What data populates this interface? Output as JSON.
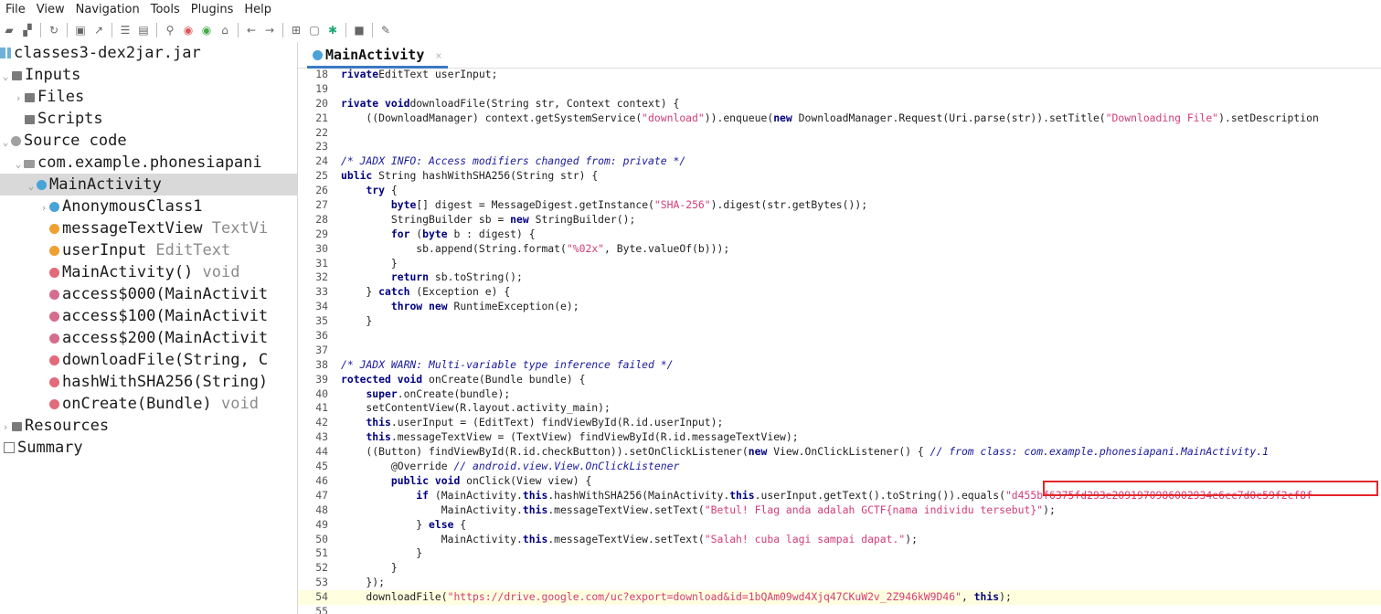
{
  "menu": [
    "File",
    "View",
    "Navigation",
    "Tools",
    "Plugins",
    "Help"
  ],
  "tree": {
    "root": "classes3-dex2jar.jar",
    "inputs": "Inputs",
    "files": "Files",
    "scripts": "Scripts",
    "source_code": "Source code",
    "package": "com.example.phonesiapani",
    "class": "MainActivity",
    "members": [
      {
        "name": "AnonymousClass1",
        "type": ""
      },
      {
        "name": "messageTextView ",
        "type": "TextVi"
      },
      {
        "name": "userInput ",
        "type": "EditText"
      },
      {
        "name": "MainActivity() ",
        "type": "void"
      },
      {
        "name": "access$000(MainActivit",
        "type": ""
      },
      {
        "name": "access$100(MainActivit",
        "type": ""
      },
      {
        "name": "access$200(MainActivit",
        "type": ""
      },
      {
        "name": "downloadFile(String, C",
        "type": ""
      },
      {
        "name": "hashWithSHA256(String)",
        "type": ""
      },
      {
        "name": "onCreate(Bundle) ",
        "type": "void"
      }
    ],
    "resources": "Resources",
    "summary": "Summary"
  },
  "tab": {
    "label": "MainActivity",
    "close": "×"
  },
  "code": {
    "lines": [
      {
        "n": "18",
        "parts": [
          [
            "kw",
            "rivate"
          ],
          [
            "",
            "EditText userInput;"
          ]
        ]
      },
      {
        "n": "19",
        "parts": []
      },
      {
        "n": "20",
        "parts": [
          [
            "kw",
            "rivate void"
          ],
          [
            "",
            "downloadFile(String str, Context context) {"
          ]
        ]
      },
      {
        "n": "21",
        "parts": [
          [
            "",
            "    ((DownloadManager) context.getSystemService("
          ],
          [
            "str",
            "\"download\""
          ],
          [
            "",
            "))."
          ],
          [
            "",
            "enqueue("
          ],
          [
            "kw",
            "new"
          ],
          [
            "",
            " DownloadManager.Request(Uri.parse(str)).setTitle("
          ],
          [
            "str",
            "\"Downloading File\""
          ],
          [
            "",
            ").setDescription"
          ]
        ]
      },
      {
        "n": "22",
        "parts": [
          [
            "",
            ""
          ]
        ]
      },
      {
        "n": "23",
        "parts": []
      },
      {
        "n": "24",
        "parts": [
          [
            "cm",
            "/* JADX INFO: Access modifiers changed from: private */"
          ]
        ]
      },
      {
        "n": "25",
        "parts": [
          [
            "kw",
            "ublic"
          ],
          [
            "",
            " String hashWithSHA256(String str) {"
          ]
        ]
      },
      {
        "n": "26",
        "parts": [
          [
            "",
            "    "
          ],
          [
            "kw",
            "try"
          ],
          [
            "",
            " {"
          ]
        ]
      },
      {
        "n": "27",
        "parts": [
          [
            "",
            "        "
          ],
          [
            "kw",
            "byte"
          ],
          [
            "",
            "[] digest = MessageDigest.getInstance("
          ],
          [
            "str",
            "\"SHA-256\""
          ],
          [
            "",
            ").digest(str.getBytes());"
          ]
        ]
      },
      {
        "n": "28",
        "parts": [
          [
            "",
            "        StringBuilder sb = "
          ],
          [
            "kw",
            "new"
          ],
          [
            "",
            " StringBuilder();"
          ]
        ]
      },
      {
        "n": "29",
        "parts": [
          [
            "",
            "        "
          ],
          [
            "kw",
            "for"
          ],
          [
            "",
            " ("
          ],
          [
            "kw",
            "byte"
          ],
          [
            "",
            " b : digest) {"
          ]
        ]
      },
      {
        "n": "30",
        "parts": [
          [
            "",
            "            sb.append(String.format("
          ],
          [
            "str",
            "\"%02x\""
          ],
          [
            "",
            ", Byte.valueOf(b)));"
          ]
        ]
      },
      {
        "n": "31",
        "parts": [
          [
            "",
            "        }"
          ]
        ]
      },
      {
        "n": "32",
        "parts": [
          [
            "",
            "        "
          ],
          [
            "kw",
            "return"
          ],
          [
            "",
            " sb.toString();"
          ]
        ]
      },
      {
        "n": "33",
        "parts": [
          [
            "",
            "    } "
          ],
          [
            "kw",
            "catch"
          ],
          [
            "",
            " (Exception e) {"
          ]
        ]
      },
      {
        "n": "34",
        "parts": [
          [
            "",
            "        "
          ],
          [
            "kw",
            "throw new"
          ],
          [
            "",
            " RuntimeException(e);"
          ]
        ]
      },
      {
        "n": "35",
        "parts": [
          [
            "",
            "    }"
          ]
        ]
      },
      {
        "n": "36",
        "parts": [
          [
            "",
            ""
          ]
        ]
      },
      {
        "n": "37",
        "parts": []
      },
      {
        "n": "38",
        "parts": [
          [
            "cm",
            "/* JADX WARN: Multi-variable type inference failed */"
          ]
        ]
      },
      {
        "n": "39",
        "parts": [
          [
            "kw",
            "rotected void"
          ],
          [
            "",
            " onCreate(Bundle bundle) {"
          ]
        ]
      },
      {
        "n": "40",
        "parts": [
          [
            "",
            "    "
          ],
          [
            "kw",
            "super"
          ],
          [
            "",
            ".onCreate(bundle);"
          ]
        ]
      },
      {
        "n": "41",
        "parts": [
          [
            "",
            "    setContentView(R.layout.activity_main);"
          ]
        ]
      },
      {
        "n": "42",
        "parts": [
          [
            "",
            "    "
          ],
          [
            "kw",
            "this"
          ],
          [
            "",
            ".userInput = (EditText) findViewById(R.id.userInput);"
          ]
        ]
      },
      {
        "n": "43",
        "parts": [
          [
            "",
            "    "
          ],
          [
            "kw",
            "this"
          ],
          [
            "",
            ".messageTextView = (TextView) findViewById(R.id.messageTextView);"
          ]
        ]
      },
      {
        "n": "44",
        "parts": [
          [
            "",
            "    ((Button) findViewById(R.id.checkButton)).setOnClickListener("
          ],
          [
            "kw",
            "new"
          ],
          [
            "",
            " View.OnClickListener() { "
          ],
          [
            "cm",
            "// from class: com.example.phonesiapani.MainActivity.1"
          ]
        ]
      },
      {
        "n": "45",
        "parts": [
          [
            "",
            "        @Override "
          ],
          [
            "cm",
            "// android.view.View.OnClickListener"
          ]
        ]
      },
      {
        "n": "46",
        "parts": [
          [
            "",
            "        "
          ],
          [
            "kw",
            "public void"
          ],
          [
            "",
            " onClick(View view) {"
          ]
        ]
      },
      {
        "n": "47",
        "parts": [
          [
            "",
            "            "
          ],
          [
            "kw",
            "if"
          ],
          [
            "",
            " (MainActivity."
          ],
          [
            "kw",
            "this"
          ],
          [
            "",
            ".hashWithSHA256(MainActivity."
          ],
          [
            "kw",
            "this"
          ],
          [
            "",
            ".userInput.getText().toString()).equals("
          ],
          [
            "str",
            "\"d455bf6375fd293e2091970986002934e6cc7d0c59f2cf8f"
          ]
        ]
      },
      {
        "n": "48",
        "parts": [
          [
            "",
            "                MainActivity."
          ],
          [
            "kw",
            "this"
          ],
          [
            "",
            ".messageTextView.setText("
          ],
          [
            "str",
            "\"Betul! Flag anda adalah GCTF{nama individu tersebut}\""
          ],
          [
            "",
            ");"
          ]
        ]
      },
      {
        "n": "49",
        "parts": [
          [
            "",
            "            } "
          ],
          [
            "kw",
            "else"
          ],
          [
            "",
            " {"
          ]
        ]
      },
      {
        "n": "50",
        "parts": [
          [
            "",
            "                MainActivity."
          ],
          [
            "kw",
            "this"
          ],
          [
            "",
            ".messageTextView.setText("
          ],
          [
            "str",
            "\"Salah! cuba lagi sampai dapat.\""
          ],
          [
            "",
            ");"
          ]
        ]
      },
      {
        "n": "51",
        "parts": [
          [
            "",
            "            }"
          ]
        ]
      },
      {
        "n": "52",
        "parts": [
          [
            "",
            "        }"
          ]
        ]
      },
      {
        "n": "53",
        "parts": [
          [
            "",
            "    });"
          ]
        ]
      },
      {
        "n": "54",
        "parts": [
          [
            "",
            "    downloadFile("
          ],
          [
            "str",
            "\"https://drive.google.com/uc?export=download&id=1bQAm09wd4Xjq47CKuW2v_2Z946kW9D46\""
          ],
          [
            "",
            ", "
          ],
          [
            "kw",
            "this"
          ],
          [
            "",
            ");"
          ]
        ]
      },
      {
        "n": "55",
        "parts": [
          [
            "",
            ""
          ]
        ]
      }
    ]
  },
  "colors": {
    "accent": "#3b78c2",
    "highlight_box": "#e3262a",
    "keyword": "#000080",
    "string": "#d23c78"
  }
}
